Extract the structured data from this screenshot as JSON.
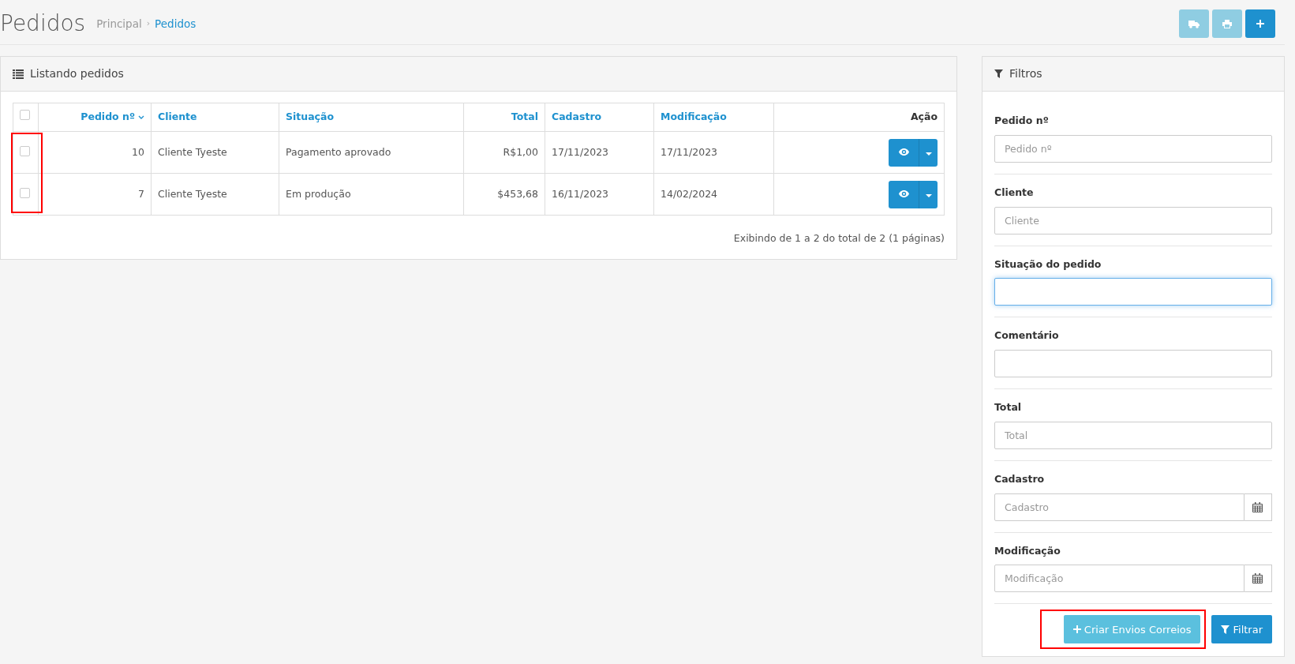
{
  "page": {
    "title": "Pedidos",
    "breadcrumb_separator": "›",
    "breadcrumb": [
      {
        "label": "Principal",
        "current": false
      },
      {
        "label": "Pedidos",
        "current": true
      }
    ]
  },
  "toolbar": [
    {
      "kind": "shipping",
      "disabled": true
    },
    {
      "kind": "print",
      "disabled": true
    },
    {
      "kind": "add",
      "disabled": false
    }
  ],
  "orders_panel": {
    "title": "Listando pedidos",
    "table": {
      "select_all": {
        "checked": false
      },
      "checkboxes_highlighted": true,
      "columns": [
        {
          "label": "Pedido nº",
          "sortable": true,
          "sorted": true
        },
        {
          "label": "Cliente",
          "sortable": true,
          "sorted": false
        },
        {
          "label": "Situação",
          "sortable": true,
          "sorted": false
        },
        {
          "label": "Total",
          "sortable": true,
          "sorted": false
        },
        {
          "label": "Cadastro",
          "sortable": true,
          "sorted": false
        },
        {
          "label": "Modificação",
          "sortable": true,
          "sorted": false
        },
        {
          "label": "Ação",
          "sortable": false,
          "sorted": false
        }
      ],
      "rows": [
        {
          "checked": false,
          "cells": [
            "10",
            "Cliente Tyeste",
            "Pagamento aprovado",
            "R$1,00",
            "17/11/2023",
            "17/11/2023"
          ]
        },
        {
          "checked": false,
          "cells": [
            "7",
            "Cliente Tyeste",
            "Em produção",
            "$453,68",
            "16/11/2023",
            "14/02/2024"
          ]
        }
      ]
    },
    "footer": "Exibindo de 1 a 2 do total de 2 (1 páginas)"
  },
  "filters_panel": {
    "title": "Filtros",
    "fields": [
      {
        "kind": "text",
        "label": "Pedido nº",
        "placeholder": "Pedido nº",
        "focused": false
      },
      {
        "kind": "text",
        "label": "Cliente",
        "placeholder": "Cliente",
        "focused": false
      },
      {
        "kind": "select",
        "label": "Situação do pedido",
        "focused": true
      },
      {
        "kind": "select",
        "label": "Comentário",
        "focused": false
      },
      {
        "kind": "text",
        "label": "Total",
        "placeholder": "Total",
        "focused": false
      },
      {
        "kind": "date",
        "label": "Cadastro",
        "placeholder": "Cadastro",
        "focused": false
      },
      {
        "kind": "date",
        "label": "Modificação",
        "placeholder": "Modificação",
        "focused": false
      }
    ],
    "buttons": [
      {
        "kind": "create",
        "label": "Criar Envios Correios",
        "highlighted": true
      },
      {
        "kind": "filter",
        "label": "Filtrar",
        "highlighted": false
      }
    ]
  }
}
